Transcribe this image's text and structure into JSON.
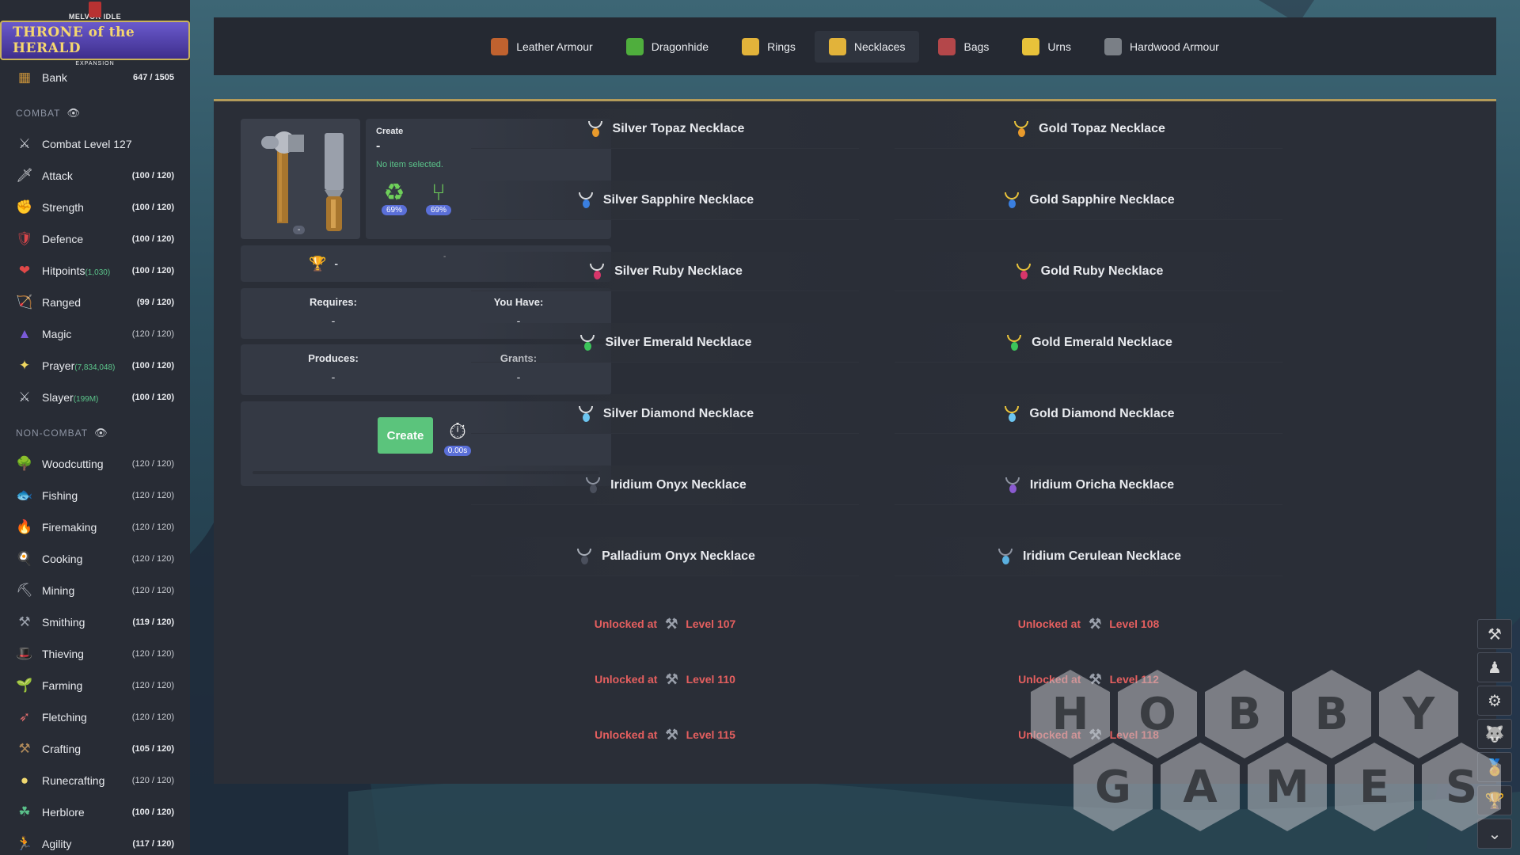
{
  "logo": {
    "top": "MELVOR IDLE",
    "title": "THRONE of the HERALD",
    "sub": "EXPANSION"
  },
  "bank": {
    "label": "Bank",
    "value": "647 / 1505"
  },
  "sections": {
    "combat": "COMBAT",
    "noncombat": "NON-COMBAT"
  },
  "combat_level": "Combat Level 127",
  "combat_skills": [
    {
      "name": "Attack",
      "xp": "",
      "level": "(100 / 120)",
      "icon": "sword-icon",
      "glyph": "🗡",
      "max": false
    },
    {
      "name": "Strength",
      "xp": "",
      "level": "(100 / 120)",
      "icon": "fist-icon",
      "glyph": "✊",
      "max": false
    },
    {
      "name": "Defence",
      "xp": "",
      "level": "(100 / 120)",
      "icon": "shield-icon",
      "glyph": "🛡",
      "max": false
    },
    {
      "name": "Hitpoints",
      "xp": "(1,030)",
      "level": "(100 / 120)",
      "icon": "heart-icon",
      "glyph": "❤",
      "max": false
    },
    {
      "name": "Ranged",
      "xp": "",
      "level": "(99 / 120)",
      "icon": "bow-icon",
      "glyph": "🏹",
      "max": false
    },
    {
      "name": "Magic",
      "xp": "",
      "level": "(120 / 120)",
      "icon": "wizard-hat-icon",
      "glyph": "▲",
      "max": true
    },
    {
      "name": "Prayer",
      "xp": "(7,834,048)",
      "level": "(100 / 120)",
      "icon": "sparkle-icon",
      "glyph": "✦",
      "max": false
    },
    {
      "name": "Slayer",
      "xp": "(199M)",
      "level": "(100 / 120)",
      "icon": "slayer-icon",
      "glyph": "⚔",
      "max": false
    }
  ],
  "noncombat_skills": [
    {
      "name": "Woodcutting",
      "level": "(120 / 120)",
      "icon": "tree-icon",
      "glyph": "🌳",
      "max": true
    },
    {
      "name": "Fishing",
      "level": "(120 / 120)",
      "icon": "fish-icon",
      "glyph": "🐟",
      "max": true
    },
    {
      "name": "Firemaking",
      "level": "(120 / 120)",
      "icon": "fire-icon",
      "glyph": "🔥",
      "max": true
    },
    {
      "name": "Cooking",
      "level": "(120 / 120)",
      "icon": "chef-hat-icon",
      "glyph": "🍳",
      "max": true
    },
    {
      "name": "Mining",
      "level": "(120 / 120)",
      "icon": "pickaxe-icon",
      "glyph": "⛏",
      "max": true
    },
    {
      "name": "Smithing",
      "level": "(119 / 120)",
      "icon": "anvil-icon",
      "glyph": "⚒",
      "max": false
    },
    {
      "name": "Thieving",
      "level": "(120 / 120)",
      "icon": "thief-icon",
      "glyph": "🎩",
      "max": true
    },
    {
      "name": "Farming",
      "level": "(120 / 120)",
      "icon": "sprout-icon",
      "glyph": "🌱",
      "max": true
    },
    {
      "name": "Fletching",
      "level": "(120 / 120)",
      "icon": "arrow-icon",
      "glyph": "➶",
      "max": true
    },
    {
      "name": "Crafting",
      "level": "(105 / 120)",
      "icon": "crafting-icon",
      "glyph": "⚒",
      "max": false
    },
    {
      "name": "Runecrafting",
      "level": "(120 / 120)",
      "icon": "rune-icon",
      "glyph": "●",
      "max": true
    },
    {
      "name": "Herblore",
      "level": "(100 / 120)",
      "icon": "herb-icon",
      "glyph": "☘",
      "max": false
    },
    {
      "name": "Agility",
      "level": "(117 / 120)",
      "icon": "agility-icon",
      "glyph": "🏃",
      "max": false
    }
  ],
  "tabs": [
    {
      "label": "Leather Armour",
      "icon": "leather-armour-icon",
      "color": "#c0622f",
      "active": false
    },
    {
      "label": "Dragonhide",
      "icon": "dragonhide-icon",
      "color": "#4fae3d",
      "active": false
    },
    {
      "label": "Rings",
      "icon": "ring-icon",
      "color": "#e2b33a",
      "active": false
    },
    {
      "label": "Necklaces",
      "icon": "necklace-icon",
      "color": "#e2b33a",
      "active": true
    },
    {
      "label": "Bags",
      "icon": "bag-icon",
      "color": "#b4474a",
      "active": false
    },
    {
      "label": "Urns",
      "icon": "urn-icon",
      "color": "#e8c23a",
      "active": false
    },
    {
      "label": "Hardwood Armour",
      "icon": "hardwood-armour-icon",
      "color": "#7a7f86",
      "active": false
    }
  ],
  "create_panel": {
    "title": "Create",
    "item": "-",
    "status": "No item selected.",
    "preserve_pct": "69%",
    "double_pct": "69%",
    "tool_badge": "-",
    "mastery_value": "-",
    "mastery_small": "-",
    "requires_label": "Requires:",
    "requires_value": "-",
    "have_label": "You Have:",
    "have_value": "-",
    "produces_label": "Produces:",
    "produces_value": "-",
    "grants_label": "Grants:",
    "grants_value": "-",
    "create_button": "Create",
    "timer": "0.00s"
  },
  "necklaces_left": [
    {
      "name": "Silver Topaz Necklace",
      "chain": "#d7d9dc",
      "gem": "#e89a2c"
    },
    {
      "name": "Silver Sapphire Necklace",
      "chain": "#d7d9dc",
      "gem": "#3a7fe0"
    },
    {
      "name": "Silver Ruby Necklace",
      "chain": "#d7d9dc",
      "gem": "#d8366a"
    },
    {
      "name": "Silver Emerald Necklace",
      "chain": "#d7d9dc",
      "gem": "#3cc45a"
    },
    {
      "name": "Silver Diamond Necklace",
      "chain": "#d7d9dc",
      "gem": "#6cc5f0"
    },
    {
      "name": "Iridium Onyx Necklace",
      "chain": "#8d93a0",
      "gem": "#4a4f5c"
    },
    {
      "name": "Palladium Onyx Necklace",
      "chain": "#a8aeb8",
      "gem": "#4a4f5c"
    }
  ],
  "necklaces_right": [
    {
      "name": "Gold Topaz Necklace",
      "chain": "#e8c23a",
      "gem": "#e89a2c"
    },
    {
      "name": "Gold Sapphire Necklace",
      "chain": "#e8c23a",
      "gem": "#3a7fe0"
    },
    {
      "name": "Gold Ruby Necklace",
      "chain": "#e8c23a",
      "gem": "#d8366a"
    },
    {
      "name": "Gold Emerald Necklace",
      "chain": "#e8c23a",
      "gem": "#3cc45a"
    },
    {
      "name": "Gold Diamond Necklace",
      "chain": "#e8c23a",
      "gem": "#6cc5f0"
    },
    {
      "name": "Iridium Oricha Necklace",
      "chain": "#8d93a0",
      "gem": "#8a5ad0"
    },
    {
      "name": "Iridium Cerulean Necklace",
      "chain": "#8d93a0",
      "gem": "#5ab0e0"
    }
  ],
  "locked_left": [
    {
      "prefix": "Unlocked at",
      "level": "Level 107"
    },
    {
      "prefix": "Unlocked at",
      "level": "Level 110"
    },
    {
      "prefix": "Unlocked at",
      "level": "Level 115"
    }
  ],
  "locked_right": [
    {
      "prefix": "Unlocked at",
      "level": "Level 108"
    },
    {
      "prefix": "Unlocked at",
      "level": "Level 112"
    },
    {
      "prefix": "Unlocked at",
      "level": "Level 118"
    }
  ],
  "right_toolbar": [
    {
      "icon": "crafting-tools-icon",
      "glyph": "⚒"
    },
    {
      "icon": "character-icon",
      "glyph": "♟"
    },
    {
      "icon": "settings-gear-icon",
      "glyph": "⚙"
    },
    {
      "icon": "pet-icon",
      "glyph": "🐺"
    },
    {
      "icon": "medal-icon",
      "glyph": "🏅"
    },
    {
      "icon": "trophy-icon",
      "glyph": "🏆"
    },
    {
      "icon": "chevron-down-icon",
      "glyph": "⌄"
    }
  ],
  "watermark": {
    "line1": [
      "H",
      "O",
      "B",
      "B",
      "Y"
    ],
    "line2": [
      "G",
      "A",
      "M",
      "E",
      "S"
    ]
  }
}
